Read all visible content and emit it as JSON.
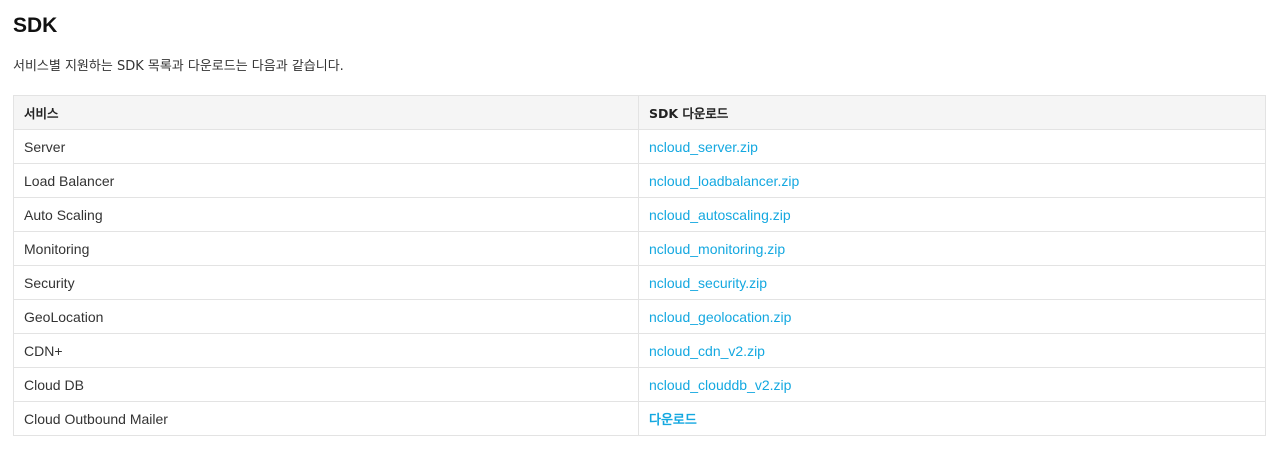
{
  "page": {
    "title": "SDK",
    "description": "서비스별 지원하는 SDK 목록과 다운로드는 다음과 같습니다."
  },
  "table": {
    "headers": {
      "service": "서비스",
      "download": "SDK 다운로드"
    },
    "rows": [
      {
        "service": "Server",
        "download": "ncloud_server.zip"
      },
      {
        "service": "Load Balancer",
        "download": "ncloud_loadbalancer.zip"
      },
      {
        "service": "Auto Scaling",
        "download": "ncloud_autoscaling.zip"
      },
      {
        "service": "Monitoring",
        "download": "ncloud_monitoring.zip"
      },
      {
        "service": "Security",
        "download": "ncloud_security.zip"
      },
      {
        "service": "GeoLocation",
        "download": "ncloud_geolocation.zip"
      },
      {
        "service": "CDN+",
        "download": "ncloud_cdn_v2.zip"
      },
      {
        "service": "Cloud DB",
        "download": "ncloud_clouddb_v2.zip"
      },
      {
        "service": "Cloud Outbound Mailer",
        "download": "다운로드"
      }
    ]
  },
  "colors": {
    "link": "#14a8e0",
    "header_bg": "#f5f5f5",
    "border": "#e3e3e3"
  }
}
